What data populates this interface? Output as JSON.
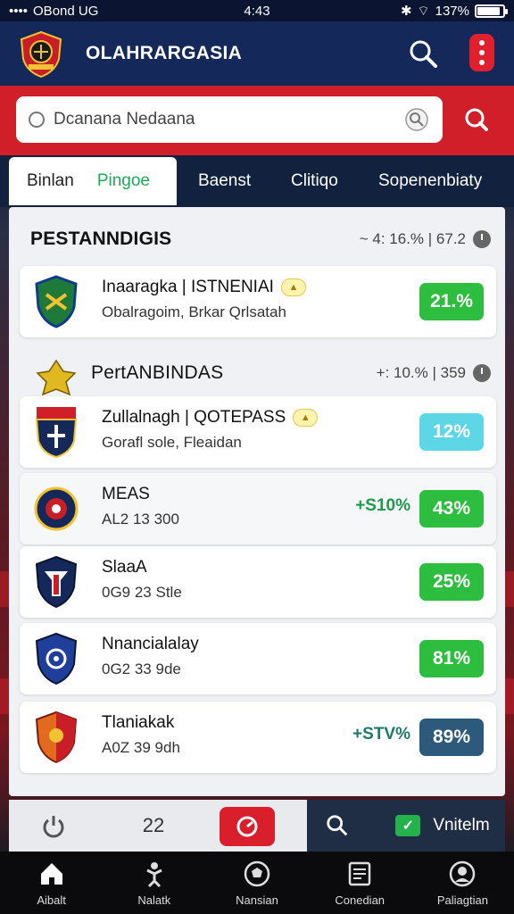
{
  "status_bar": {
    "carrier": "OBond UG",
    "time": "4:43",
    "battery_text": "137%",
    "battery_level": 0.9
  },
  "header": {
    "title": "OLAHRARGASIA"
  },
  "search": {
    "placeholder": "Dcanana Nedaana"
  },
  "tabs": [
    {
      "label": "Binlan",
      "sub": "Pingoe",
      "active": true
    },
    {
      "label": "Baenst"
    },
    {
      "label": "Clitiqo"
    },
    {
      "label": "Sopenenbiaty"
    }
  ],
  "sections": [
    {
      "title": "PESTANNDIGIS",
      "meta": "~ 4: 16.% | 67.2"
    },
    {
      "title": "PertANBINDAS",
      "meta": "+: 10.% | 359"
    }
  ],
  "cards": [
    {
      "name": "Inaaragka | ISTNENIAI",
      "sub": "Obalragoim, Brkar Qrlsatah",
      "value": "21.%",
      "change": "",
      "pill_color": "#2dbe3f",
      "crest": "shield-green"
    },
    {
      "name": "Zullalnagh | QOTEPASS",
      "sub": "Gorafl sole, Fleaidan",
      "value": "12%",
      "change": "",
      "pill_color": "#5dd6e6",
      "crest": "shield-navy"
    },
    {
      "name": "MEAS",
      "sub": "AL2 13 300",
      "value": "43%",
      "change": "+S10%",
      "pill_color": "#2dbe3f",
      "crest": "round-badge"
    },
    {
      "name": "SlaaA",
      "sub": "0G9 23 Stle",
      "value": "25%",
      "change": "",
      "pill_color": "#2dbe3f",
      "crest": "shield-red"
    },
    {
      "name": "Nnancialalay",
      "sub": "0G2 33 9de",
      "value": "81%",
      "change": "",
      "pill_color": "#2dbe3f",
      "crest": "shield-blue"
    },
    {
      "name": "Tlaniakak",
      "sub": "A0Z 39 9dh",
      "value": "89%",
      "change": "+STV%",
      "pill_color": "#2d5a7a",
      "crest": "shield-orange"
    }
  ],
  "action_bar": {
    "count": "22",
    "confirm_label": "Vnitelm"
  },
  "bottom_nav": [
    {
      "label": "Aibalt",
      "icon": "home-icon"
    },
    {
      "label": "Nalatk",
      "icon": "player-icon"
    },
    {
      "label": "Nansian",
      "icon": "ball-icon"
    },
    {
      "label": "Conedian",
      "icon": "news-icon"
    },
    {
      "label": "Paliagtian",
      "icon": "profile-icon"
    }
  ]
}
